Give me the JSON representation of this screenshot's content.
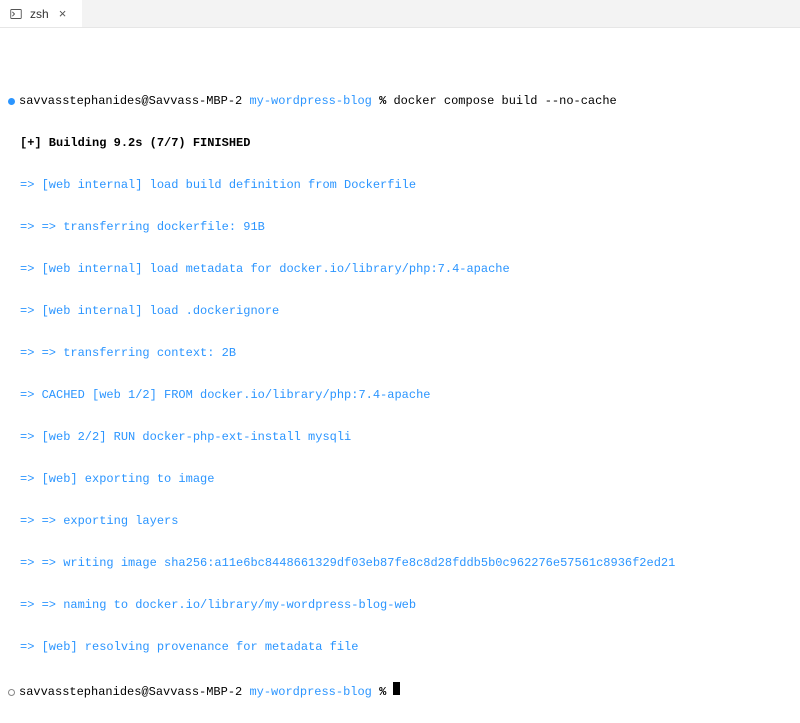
{
  "tab": {
    "label": "zsh"
  },
  "prompt1": {
    "userhost": "savvasstephanides@Savvass-MBP-2",
    "dir": "my-wordpress-blog",
    "symbol": "%",
    "command": "docker compose build --no-cache"
  },
  "build": {
    "header": "[+] Building 9.2s (7/7) FINISHED",
    "lines": [
      "=> [web internal] load build definition from Dockerfile",
      "=> => transferring dockerfile: 91B",
      "=> [web internal] load metadata for docker.io/library/php:7.4-apache",
      "=> [web internal] load .dockerignore",
      "=> => transferring context: 2B",
      "=> CACHED [web 1/2] FROM docker.io/library/php:7.4-apache",
      "=> [web 2/2] RUN docker-php-ext-install mysqli",
      "=> [web] exporting to image",
      "=> => exporting layers",
      "=> => writing image sha256:a11e6bc8448661329df03eb87fe8c8d28fddb5b0c962276e57561c8936f2ed21",
      "=> => naming to docker.io/library/my-wordpress-blog-web",
      "=> [web] resolving provenance for metadata file"
    ]
  },
  "prompt2": {
    "userhost": "savvasstephanides@Savvass-MBP-2",
    "dir": "my-wordpress-blog",
    "symbol": "%"
  }
}
